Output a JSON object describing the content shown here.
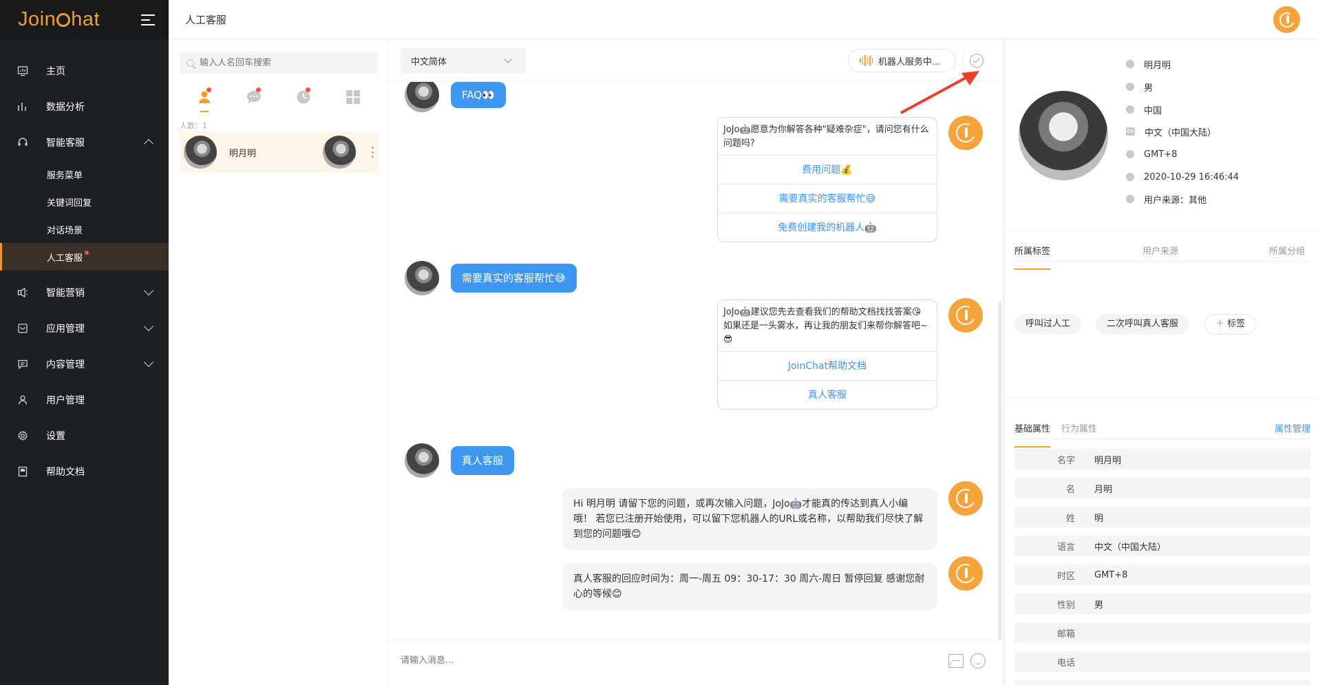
{
  "app": {
    "logo_text_left": "Join",
    "logo_text_right": "hat"
  },
  "sidebar": {
    "items": [
      {
        "label": "主页",
        "icon": "monitor-icon"
      },
      {
        "label": "数据分析",
        "icon": "bar-chart-icon"
      },
      {
        "label": "智能客服",
        "icon": "headset-icon",
        "expanded": true,
        "children": [
          {
            "label": "服务菜单"
          },
          {
            "label": "关键词回复"
          },
          {
            "label": "对话场景"
          },
          {
            "label": "人工客服",
            "active": true,
            "badge": true
          }
        ]
      },
      {
        "label": "智能营销",
        "icon": "megaphone-icon"
      },
      {
        "label": "应用管理",
        "icon": "app-icon"
      },
      {
        "label": "内容管理",
        "icon": "comment-icon"
      },
      {
        "label": "用户管理",
        "icon": "user-icon"
      },
      {
        "label": "设置",
        "icon": "gear-icon"
      },
      {
        "label": "帮助文档",
        "icon": "book-icon"
      }
    ]
  },
  "header": {
    "title": "人工客服"
  },
  "conversations": {
    "search_placeholder": "输入人名回车搜索",
    "count_label": "人数：1",
    "items": [
      {
        "name": "明月明"
      }
    ]
  },
  "chat": {
    "language": "中文简体",
    "bot_status": "机器人服务中...",
    "input_placeholder": "请输入消息...",
    "messages": {
      "user1": "FAQ👀",
      "card1_text": "JoJo🤖愿意为你解答各种\"疑难杂症\"，请问您有什么问题吗?",
      "card1_options": [
        "费用问题💰",
        "需要真实的客服帮忙😅",
        "免费创建我的机器人🤖"
      ],
      "user2": "需要真实的客服帮忙😅",
      "card2_text_1": "JoJo🤖建议您先去查看我们的帮助文档找找答案😘",
      "card2_text_2": "如果还是一头雾水，再让我的朋友们来帮你解答吧~😎",
      "card2_options": [
        "JoinChat帮助文档",
        "真人客服"
      ],
      "user3": "真人客服",
      "bot3": "Hi 明月明 请留下您的问题，或再次输入问题，JoJo🤖才能真的传达到真人小编哦！ 若您已注册开始使用，可以留下您机器人的URL或名称，以帮助我们尽快了解到您的问题哦😊",
      "bot4": "真人客服的回应时间为：周一-周五 09：30-17：30 周六-周日 暂停回复 感谢您耐心的等候😊"
    }
  },
  "profile": {
    "name": "明月明",
    "gender": "男",
    "country": "中国",
    "language": "中文（中国大陆）",
    "language_icon_text": "EN",
    "timezone": "GMT+8",
    "datetime": "2020-10-29 16:46:44",
    "source": "用户来源：其他",
    "tag_tabs": [
      "所属标签",
      "用户来源",
      "所属分组"
    ],
    "tags": [
      "呼叫过人工",
      "二次呼叫真人客服"
    ],
    "add_tag": "标签",
    "attr_tabs": [
      "基础属性",
      "行为属性"
    ],
    "attr_manage": "属性管理",
    "attributes": [
      {
        "k": "名字",
        "v": "明月明"
      },
      {
        "k": "名",
        "v": "月明"
      },
      {
        "k": "姓",
        "v": "明"
      },
      {
        "k": "语言",
        "v": "中文（中国大陆）"
      },
      {
        "k": "时区",
        "v": "GMT+8"
      },
      {
        "k": "性别",
        "v": "男"
      },
      {
        "k": "邮箱",
        "v": ""
      },
      {
        "k": "电话",
        "v": ""
      }
    ]
  },
  "colors": {
    "accent": "#f0a028",
    "link": "#3d96f0",
    "sidebar_bg": "#1d2023",
    "badge": "#ff4d4f",
    "annotation_arrow": "#e8402a"
  }
}
